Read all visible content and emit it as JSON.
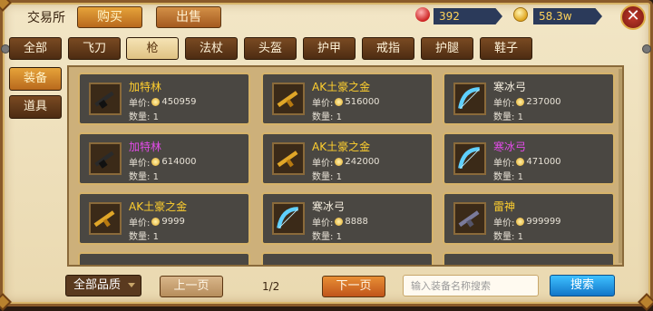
{
  "header": {
    "title": "交易所",
    "tabs": [
      {
        "label": "购买",
        "active": true
      },
      {
        "label": "出售",
        "active": false
      }
    ],
    "gem_amount": "392",
    "coin_amount": "58.3w"
  },
  "categories": [
    {
      "label": "全部",
      "active": false
    },
    {
      "label": "飞刀",
      "active": false
    },
    {
      "label": "枪",
      "active": true
    },
    {
      "label": "法杖",
      "active": false
    },
    {
      "label": "头盔",
      "active": false
    },
    {
      "label": "护甲",
      "active": false
    },
    {
      "label": "戒指",
      "active": false
    },
    {
      "label": "护腿",
      "active": false
    },
    {
      "label": "鞋子",
      "active": false
    }
  ],
  "side_tabs": [
    {
      "label": "装备",
      "active": true
    },
    {
      "label": "道具",
      "active": false
    }
  ],
  "items": [
    {
      "name": "加特林",
      "rarity": "gold",
      "price_label": "单价:",
      "price": "450959",
      "qty_label": "数量:",
      "qty": "1",
      "icon": "gatling-icon"
    },
    {
      "name": "AK土豪之金",
      "rarity": "gold",
      "price_label": "单价:",
      "price": "516000",
      "qty_label": "数量:",
      "qty": "1",
      "icon": "ak-gold-icon"
    },
    {
      "name": "寒冰弓",
      "rarity": "plain",
      "price_label": "单价:",
      "price": "237000",
      "qty_label": "数量:",
      "qty": "1",
      "icon": "ice-bow-icon"
    },
    {
      "name": "加特林",
      "rarity": "rare",
      "price_label": "单价:",
      "price": "614000",
      "qty_label": "数量:",
      "qty": "1",
      "icon": "gatling-icon"
    },
    {
      "name": "AK土豪之金",
      "rarity": "gold",
      "price_label": "单价:",
      "price": "242000",
      "qty_label": "数量:",
      "qty": "1",
      "icon": "ak-gold-icon"
    },
    {
      "name": "寒冰弓",
      "rarity": "rare",
      "price_label": "单价:",
      "price": "471000",
      "qty_label": "数量:",
      "qty": "1",
      "icon": "ice-bow-icon"
    },
    {
      "name": "AK土豪之金",
      "rarity": "gold",
      "price_label": "单价:",
      "price": "9999",
      "qty_label": "数量:",
      "qty": "1",
      "icon": "ak-gold-icon"
    },
    {
      "name": "寒冰弓",
      "rarity": "plain",
      "price_label": "单价:",
      "price": "8888",
      "qty_label": "数量:",
      "qty": "1",
      "icon": "ice-bow-icon"
    },
    {
      "name": "雷神",
      "rarity": "gold",
      "price_label": "单价:",
      "price": "999999",
      "qty_label": "数量:",
      "qty": "1",
      "icon": "thor-gun-icon"
    }
  ],
  "footer": {
    "grade_filter": "全部品质",
    "prev_label": "上一页",
    "page_indicator": "1/2",
    "next_label": "下一页",
    "search_placeholder": "输入装备名称搜索",
    "search_label": "搜索"
  },
  "colors": {
    "gold_name": "#ffcf2e",
    "rare_name": "#e24be8",
    "accent_orange": "#e6a33a",
    "search_blue": "#1e90e0"
  }
}
